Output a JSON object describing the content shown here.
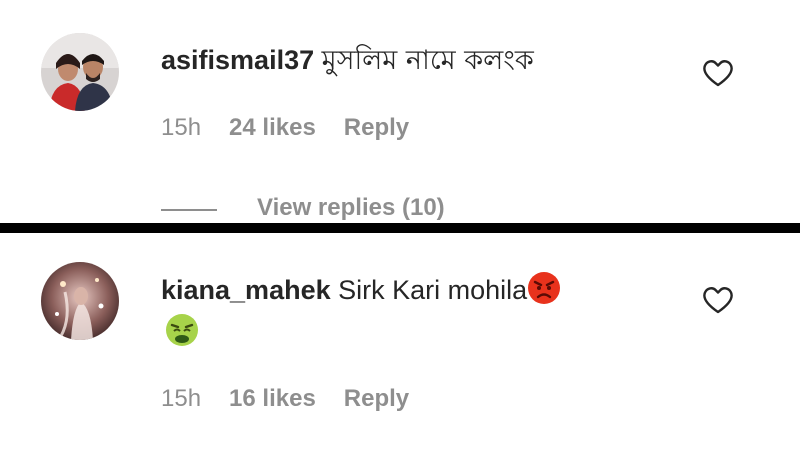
{
  "comments": [
    {
      "username": "asifismail37",
      "text": "মুসলিম নামে কলংক",
      "time": "15h",
      "likes": "24 likes",
      "reply": "Reply",
      "avatar_icon": "profile-photo-couple",
      "like_icon": "heart-outline-icon",
      "view_replies": "View replies (10)"
    },
    {
      "username": "kiana_mahek",
      "text": "Sirk Kari mohila",
      "emojis": [
        "angry-face-emoji",
        "nauseated-face-emoji"
      ],
      "time": "15h",
      "likes": "16 likes",
      "reply": "Reply",
      "avatar_icon": "profile-photo-sparkle",
      "like_icon": "heart-outline-icon"
    }
  ],
  "colors": {
    "text": "#262626",
    "secondary": "#8e8e8e",
    "divider": "#000000",
    "angry_emoji": "#e8321c",
    "nausea_emoji": "#8bc34a"
  }
}
